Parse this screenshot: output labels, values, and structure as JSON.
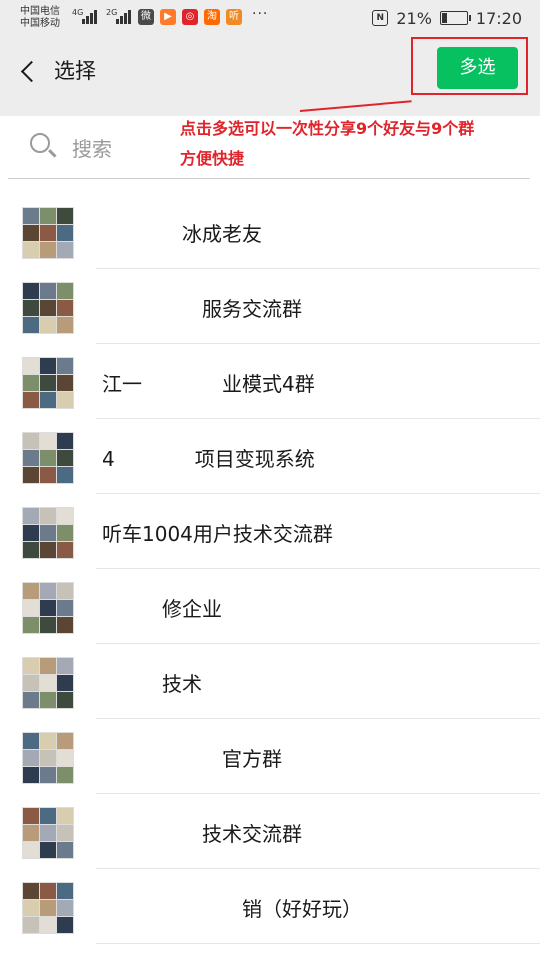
{
  "status_bar": {
    "carrier_1": "中国电信",
    "carrier_2": "中国移动",
    "signal_1": "4G",
    "signal_2": "2G",
    "dots": "···",
    "battery_percent": "21%",
    "battery_level": 0.21,
    "time": "17:20",
    "apps": [
      "微",
      "▶",
      "◎",
      "淘",
      "听"
    ]
  },
  "header": {
    "title": "选择",
    "multi_select_label": "多选"
  },
  "search": {
    "placeholder": "搜索"
  },
  "annotation": {
    "line1": "点击多选可以一次性分享9个好友与9个群",
    "line2": "方便快捷"
  },
  "colors": {
    "accent": "#07c160",
    "annotation": "#e0242b",
    "header_bg": "#ededed"
  },
  "chats": [
    {
      "name": "　　　　冰成老友"
    },
    {
      "name": "　　　　　服务交流群"
    },
    {
      "name": "江一　　　　业模式4群"
    },
    {
      "name": "4　　　　项目变现系统"
    },
    {
      "name": "听车1004用户技术交流群"
    },
    {
      "name": "　　　修企业"
    },
    {
      "name": "　　　技术"
    },
    {
      "name": "　　　　　　官方群"
    },
    {
      "name": "　　　　　技术交流群"
    },
    {
      "name": "　　　　　　　销（好好玩）"
    }
  ]
}
